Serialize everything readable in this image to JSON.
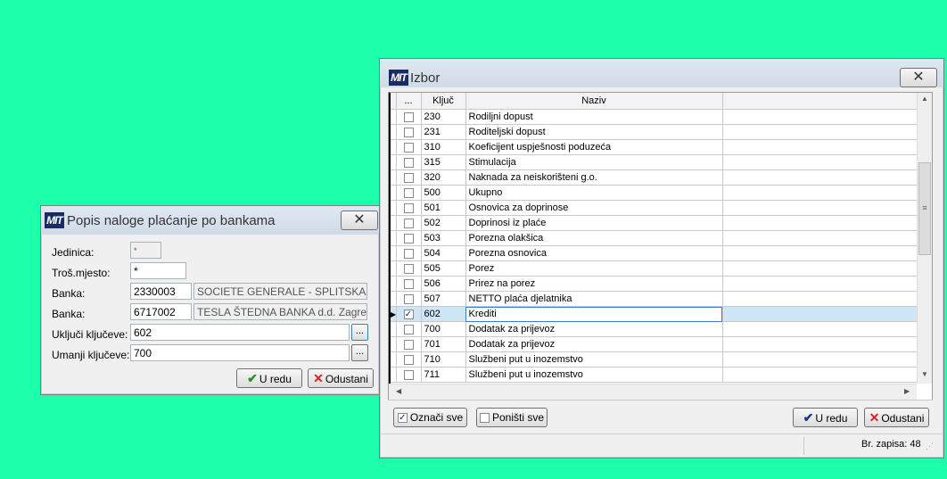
{
  "dialog_popis": {
    "title": "Popis naloge plaćanje po bankama",
    "logo": "MIT",
    "close_icon": "close-icon",
    "labels": {
      "jedinica": "Jedinica:",
      "tros_mjesto": "Troš.mjesto:",
      "banka1": "Banka:",
      "banka2": "Banka:",
      "ukljuci": "Uključi ključeve:",
      "umanji": "Umanji ključeve:"
    },
    "values": {
      "jedinica": "*",
      "tros_mjesto": "*",
      "banka1_code": "2330003",
      "banka1_name": "SOCIETE GENERALE - SPLITSKA BAN",
      "banka2_code": "6717002",
      "banka2_name": "TESLA ŠTEDNA BANKA d.d. Zagreb",
      "ukljuci": "602",
      "umanji": "700"
    },
    "dots": "...",
    "ok_label": "U redu",
    "cancel_label": "Odustani"
  },
  "dialog_izbor": {
    "title": "Izbor",
    "logo": "MIT",
    "columns": [
      "...",
      "Ključ",
      "Naziv"
    ],
    "rows": [
      {
        "key": "230",
        "name": "Rodiljni dopust",
        "checked": false
      },
      {
        "key": "231",
        "name": "Roditeljski dopust",
        "checked": false
      },
      {
        "key": "310",
        "name": "Koeficijent uspješnosti poduzeća",
        "checked": false
      },
      {
        "key": "315",
        "name": "Stimulacija",
        "checked": false
      },
      {
        "key": "320",
        "name": "Naknada za neiskorišteni g.o.",
        "checked": false
      },
      {
        "key": "500",
        "name": "Ukupno",
        "checked": false
      },
      {
        "key": "501",
        "name": "Osnovica za doprinose",
        "checked": false
      },
      {
        "key": "502",
        "name": "Doprinosi iz plaće",
        "checked": false
      },
      {
        "key": "503",
        "name": "Porezna olakšica",
        "checked": false
      },
      {
        "key": "504",
        "name": "Porezna osnovica",
        "checked": false
      },
      {
        "key": "505",
        "name": "Porez",
        "checked": false
      },
      {
        "key": "506",
        "name": "Prirez na porez",
        "checked": false
      },
      {
        "key": "507",
        "name": "NETTO plaća djelatnika",
        "checked": false
      },
      {
        "key": "602",
        "name": "Krediti",
        "checked": true
      },
      {
        "key": "700",
        "name": "Dodatak za prijevoz",
        "checked": false
      },
      {
        "key": "701",
        "name": "Dodatak za prijevoz",
        "checked": false
      },
      {
        "key": "710",
        "name": "Službeni put u inozemstvo",
        "checked": false
      },
      {
        "key": "711",
        "name": "Službeni put u inozemstvo",
        "checked": false
      }
    ],
    "select_all_label": "Označi sve",
    "deselect_all_label": "Poništi sve",
    "ok_label": "U redu",
    "cancel_label": "Odustani",
    "status": "Br. zapisa: 48"
  },
  "colors": {
    "desktop": "#1dffaa",
    "logo": "#1a2a66",
    "selected_row": "#cfe6f6"
  }
}
